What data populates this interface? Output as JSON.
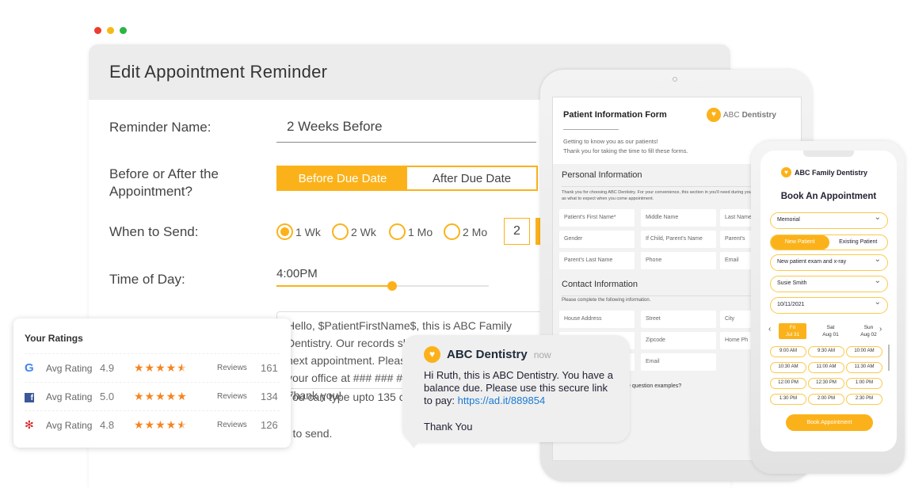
{
  "window": {
    "title": "Edit Appointment Reminder"
  },
  "form": {
    "reminder_name_label": "Reminder Name:",
    "reminder_name_value": "2 Weeks Before",
    "before_after_label_1": "Before or After the",
    "before_after_label_2": "Appointment?",
    "before_label": "Before Due Date",
    "after_label": "After Due Date",
    "selected": "Before Due Date",
    "when_label": "When to Send:",
    "when_options": [
      "1 Wk",
      "2 Wk",
      "1 Mo",
      "2 Mo"
    ],
    "when_selected": "1 Wk",
    "custom_value": "2",
    "time_label": "Time of Day:",
    "time_value": "4:00PM",
    "time_slider_fraction": 0.545,
    "message_lines": [
      "Hello, $PatientFirstName$, this is ABC Family",
      "Dentistry. Our records show you are overdue for your",
      "next appointment. Please",
      "your office at ### ### ###",
      "Thank you!"
    ],
    "char_hint": "You can type upto 135 ch",
    "send_hint": "r to send."
  },
  "ratings": {
    "title": "Your Ratings",
    "rows": [
      {
        "source": "google-icon",
        "label": "Avg Rating",
        "value": "4.9",
        "stars": 4.5,
        "reviews_label": "Reviews",
        "reviews": "161"
      },
      {
        "source": "facebook-icon",
        "label": "Avg Rating",
        "value": "5.0",
        "stars": 5,
        "reviews_label": "Reviews",
        "reviews": "134"
      },
      {
        "source": "yelp-icon",
        "label": "Avg Rating",
        "value": "4.8",
        "stars": 4.5,
        "reviews_label": "Reviews",
        "reviews": "126"
      }
    ]
  },
  "sms": {
    "sender": "ABC Dentistry",
    "time": "now",
    "body": "Hi Ruth, this is ABC Dentistry. You have a balance due. Please use this secure link to pay: ",
    "link": "https://ad.it/889854",
    "closing": "Thank You"
  },
  "tablet": {
    "title": "Patient Information Form",
    "brand_light": "ABC ",
    "brand_bold": "Dentistry",
    "intro_1": "Getting to know you as our patients!",
    "intro_2": "Thank you for taking the time to fill these forms.",
    "personal_heading": "Personal Information",
    "personal_text": "Thank you for choosing ABC Dentistry. For your convenience, this section in you'll need during your first visit, as well as what to expect when you come appointment.",
    "personal_fields": [
      "Patient's First Name*",
      "Middle Name",
      "Last Name",
      "Gender",
      "If Child, Parent's Name",
      "Parent's",
      "Parent's Last Name",
      "Phone",
      "Email"
    ],
    "contact_heading": "Contact Information",
    "contact_text": "Please complete the following information.",
    "contact_fields": [
      "House Address",
      "Street",
      "City",
      "",
      "Zipcode",
      "Home Ph",
      "",
      "Email"
    ],
    "question_text": "e question examples?"
  },
  "phone": {
    "brand": "ABC Family Dentistry",
    "title": "Book An Appointment",
    "location": "Memorial",
    "new_patient": "New Patient",
    "existing_patient": "Existing Patient",
    "service": "New patient exam and x-ray",
    "person": "Susie Smith",
    "date": "10/11/2021",
    "days": [
      {
        "d": "Fri",
        "m": "Jul 31"
      },
      {
        "d": "Sat",
        "m": "Aug 01"
      },
      {
        "d": "Sun",
        "m": "Aug 02"
      }
    ],
    "times": [
      "9:00 AM",
      "9:30 AM",
      "10:00 AM",
      "10:30 AM",
      "11:00 AM",
      "11:30 AM",
      "12:00 PM",
      "12:30 PM",
      "1:00 PM",
      "1:30 PM",
      "2:00 PM",
      "2:30 PM"
    ],
    "book_label": "Book Appointment"
  },
  "colors": {
    "accent": "#fbb21a",
    "star": "#f5841f",
    "link": "#1a7ad4"
  }
}
